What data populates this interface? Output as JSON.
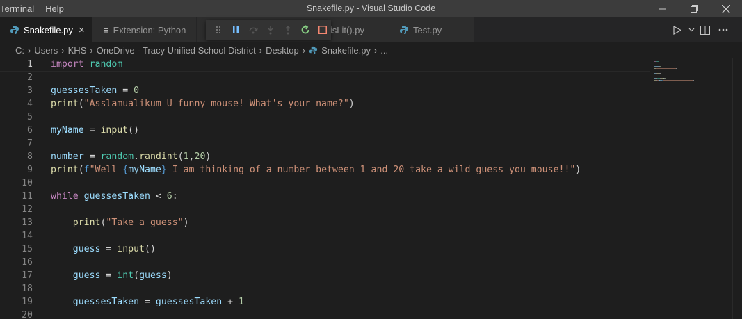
{
  "menu": {
    "items": [
      "Terminal",
      "Help"
    ]
  },
  "window": {
    "title": "Snakefile.py - Visual Studio Code"
  },
  "tabs": [
    {
      "label": "Snakefile.py",
      "active": true,
      "icon": "python-icon",
      "close": "×"
    },
    {
      "label": "Extension: Python",
      "active": false,
      "icon": "extension-icon"
    },
    {
      "label": "g isLit().py",
      "active": false,
      "icon": "python-icon"
    },
    {
      "label": "Test.py",
      "active": false,
      "icon": "python-icon"
    }
  ],
  "breadcrumb": [
    "C:",
    "Users",
    "KHS",
    "OneDrive - Tracy Unified School District",
    "Desktop",
    "Snakefile.py",
    "..."
  ],
  "editor": {
    "current_line": 1,
    "lines": [
      [
        [
          "kw",
          "import"
        ],
        [
          "t",
          " "
        ],
        [
          "mod",
          "random"
        ]
      ],
      [],
      [
        [
          "var",
          "guessesTaken"
        ],
        [
          "t",
          " = "
        ],
        [
          "num",
          "0"
        ]
      ],
      [
        [
          "fn",
          "print"
        ],
        [
          "t",
          "("
        ],
        [
          "str",
          "\"Asslamualikum U funny mouse! What's your name?\""
        ],
        [
          "t",
          ")"
        ]
      ],
      [],
      [
        [
          "var",
          "myName"
        ],
        [
          "t",
          " = "
        ],
        [
          "fn",
          "input"
        ],
        [
          "t",
          "()"
        ]
      ],
      [],
      [
        [
          "var",
          "number"
        ],
        [
          "t",
          " = "
        ],
        [
          "mod",
          "random"
        ],
        [
          "t",
          "."
        ],
        [
          "fn",
          "randint"
        ],
        [
          "t",
          "("
        ],
        [
          "num",
          "1"
        ],
        [
          "t",
          ","
        ],
        [
          "num",
          "20"
        ],
        [
          "t",
          ")"
        ]
      ],
      [
        [
          "fn",
          "print"
        ],
        [
          "t",
          "("
        ],
        [
          "blue",
          "f"
        ],
        [
          "str",
          "\"Well "
        ],
        [
          "blue",
          "{"
        ],
        [
          "var",
          "myName"
        ],
        [
          "blue",
          "}"
        ],
        [
          "str",
          " I am thinking of a number between 1 and 20 take a wild guess you mouse!!\""
        ],
        [
          "t",
          ")"
        ]
      ],
      [],
      [
        [
          "kw",
          "while"
        ],
        [
          "t",
          " "
        ],
        [
          "var",
          "guessesTaken"
        ],
        [
          "t",
          " < "
        ],
        [
          "num",
          "6"
        ],
        [
          "t",
          ":"
        ]
      ],
      [],
      [
        [
          "t",
          "    "
        ],
        [
          "fn",
          "print"
        ],
        [
          "t",
          "("
        ],
        [
          "str",
          "\"Take a guess\""
        ],
        [
          "t",
          ")"
        ]
      ],
      [],
      [
        [
          "t",
          "    "
        ],
        [
          "var",
          "guess"
        ],
        [
          "t",
          " = "
        ],
        [
          "fn",
          "input"
        ],
        [
          "t",
          "()"
        ]
      ],
      [],
      [
        [
          "t",
          "    "
        ],
        [
          "var",
          "guess"
        ],
        [
          "t",
          " = "
        ],
        [
          "mod",
          "int"
        ],
        [
          "t",
          "("
        ],
        [
          "var",
          "guess"
        ],
        [
          "t",
          ")"
        ]
      ],
      [],
      [
        [
          "t",
          "    "
        ],
        [
          "var",
          "guessesTaken"
        ],
        [
          "t",
          " = "
        ],
        [
          "var",
          "guessesTaken"
        ],
        [
          "t",
          " + "
        ],
        [
          "num",
          "1"
        ]
      ],
      []
    ]
  },
  "colors": {
    "accent": "#007acc",
    "python_icon": "#519aba",
    "debug_restart": "#89d185",
    "debug_stop": "#f48771",
    "debug_continue": "#75beff"
  }
}
